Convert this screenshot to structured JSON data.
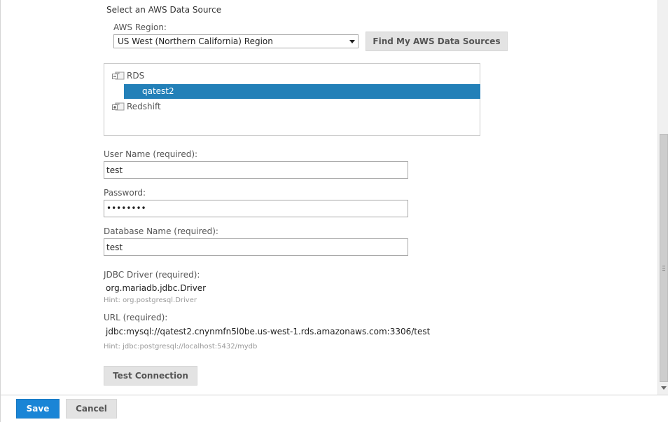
{
  "section_title": "Select an AWS Data Source",
  "region": {
    "label": "AWS Region:",
    "selected": "US West (Northern California) Region",
    "find_button": "Find My AWS Data Sources"
  },
  "tree": {
    "groups": [
      {
        "label": "RDS",
        "expanded": true,
        "children": [
          "qatest2"
        ]
      },
      {
        "label": "Redshift",
        "expanded": false,
        "children": []
      }
    ],
    "selected_item": "qatest2"
  },
  "fields": {
    "username": {
      "label": "User Name (required):",
      "value": "test"
    },
    "password": {
      "label": "Password:",
      "value": "••••••••"
    },
    "database": {
      "label": "Database Name (required):",
      "value": "test"
    }
  },
  "jdbc": {
    "label": "JDBC Driver (required):",
    "value": "org.mariadb.jdbc.Driver",
    "hint": "Hint: org.postgresql.Driver"
  },
  "url": {
    "label": "URL (required):",
    "value": "jdbc:mysql://qatest2.cnynmfn5l0be.us-west-1.rds.amazonaws.com:3306/test",
    "hint": "Hint: jdbc:postgresql://localhost:5432/mydb"
  },
  "test_button": "Test Connection",
  "footer": {
    "save": "Save",
    "cancel": "Cancel"
  },
  "colors": {
    "selection": "#2380b8",
    "primary_button": "#1a85d6"
  }
}
